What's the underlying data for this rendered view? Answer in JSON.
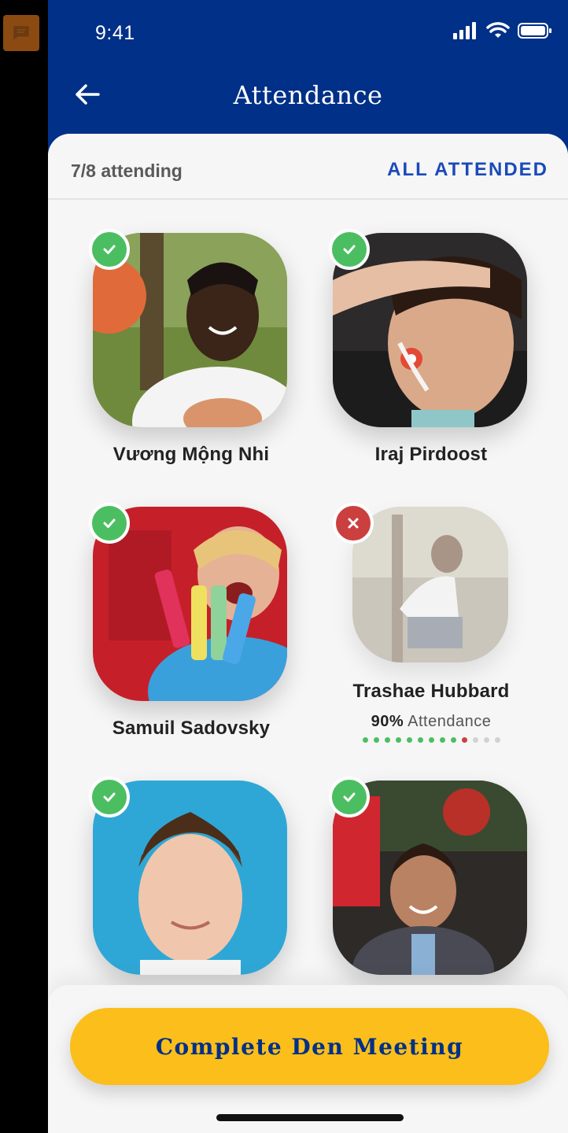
{
  "status": {
    "time": "9:41"
  },
  "nav": {
    "title": "Attendance"
  },
  "header": {
    "attending_count": "7/8 attending",
    "all_attended": "ALL ATTENDED"
  },
  "scouts": [
    {
      "name": "Vương Mộng Nhi",
      "status": "present"
    },
    {
      "name": "Iraj Pirdoost",
      "status": "present"
    },
    {
      "name": "Samuil Sadovsky",
      "status": "present"
    },
    {
      "name": "Trashae Hubbard",
      "status": "absent",
      "attendance_pct": "90%",
      "attendance_label": "Attendance",
      "attendance_history": [
        "present",
        "present",
        "present",
        "present",
        "present",
        "present",
        "present",
        "present",
        "present",
        "absent",
        "none",
        "none",
        "none"
      ]
    },
    {
      "name": "",
      "status": "present"
    },
    {
      "name": "",
      "status": "present"
    }
  ],
  "footer": {
    "complete_button": "Complete Den Meeting"
  },
  "colors": {
    "brand_blue": "#003087",
    "accent_yellow": "#fbbe1a",
    "present_green": "#4cbe62",
    "absent_red": "#cc3f3f",
    "link_blue": "#1a4ab8"
  }
}
